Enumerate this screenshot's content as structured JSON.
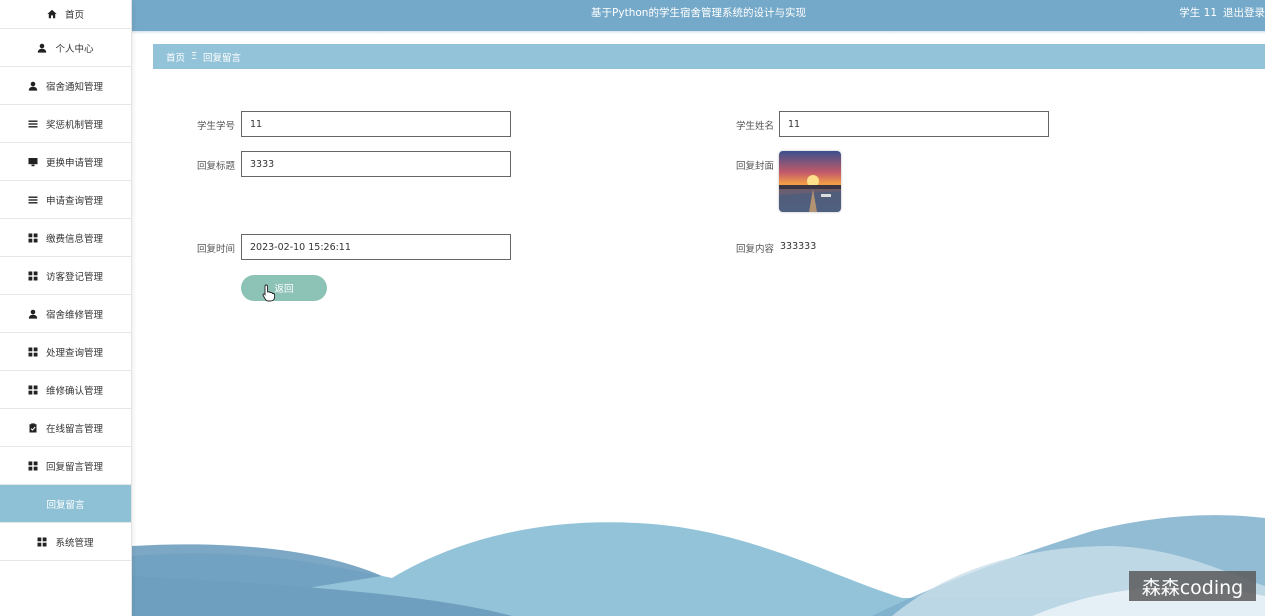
{
  "app": {
    "title": "基于Python的学生宿舍管理系统的设计与实现",
    "user_label": "学生 11",
    "logout_label": "退出登录"
  },
  "sidebar": {
    "items": [
      {
        "label": "首页",
        "icon": "home-icon"
      },
      {
        "label": "个人中心",
        "icon": "person-icon"
      },
      {
        "label": "宿舍通知管理",
        "icon": "person-icon"
      },
      {
        "label": "奖惩机制管理",
        "icon": "list-icon"
      },
      {
        "label": "更换申请管理",
        "icon": "monitor-icon"
      },
      {
        "label": "申请查询管理",
        "icon": "list-icon"
      },
      {
        "label": "缴费信息管理",
        "icon": "grid-icon"
      },
      {
        "label": "访客登记管理",
        "icon": "grid-icon"
      },
      {
        "label": "宿舍维修管理",
        "icon": "person-icon"
      },
      {
        "label": "处理查询管理",
        "icon": "grid-icon"
      },
      {
        "label": "维修确认管理",
        "icon": "grid-icon"
      },
      {
        "label": "在线留言管理",
        "icon": "clipboard-icon"
      },
      {
        "label": "回复留言管理",
        "icon": "grid-icon"
      },
      {
        "label": "回复留言",
        "icon": ""
      },
      {
        "label": "系统管理",
        "icon": "grid-icon"
      }
    ],
    "active_index": 13
  },
  "breadcrumb": {
    "home": "首页",
    "separator": "Ξ",
    "current": "回复留言"
  },
  "form": {
    "student_id_label": "学生学号",
    "student_id_value": "11",
    "student_name_label": "学生姓名",
    "student_name_value": "11",
    "reply_title_label": "回复标题",
    "reply_title_value": "3333",
    "reply_cover_label": "回复封面",
    "reply_time_label": "回复时间",
    "reply_time_value": "2023-02-10 15:26:11",
    "reply_content_label": "回复内容",
    "reply_content_value": "333333",
    "back_button": "返回"
  },
  "watermark": "森森coding",
  "colors": {
    "topbar": "#75a9c9",
    "breadcrumb": "#93c3d8",
    "active_nav": "#8fc1d6",
    "button": "#8dc3b7"
  }
}
